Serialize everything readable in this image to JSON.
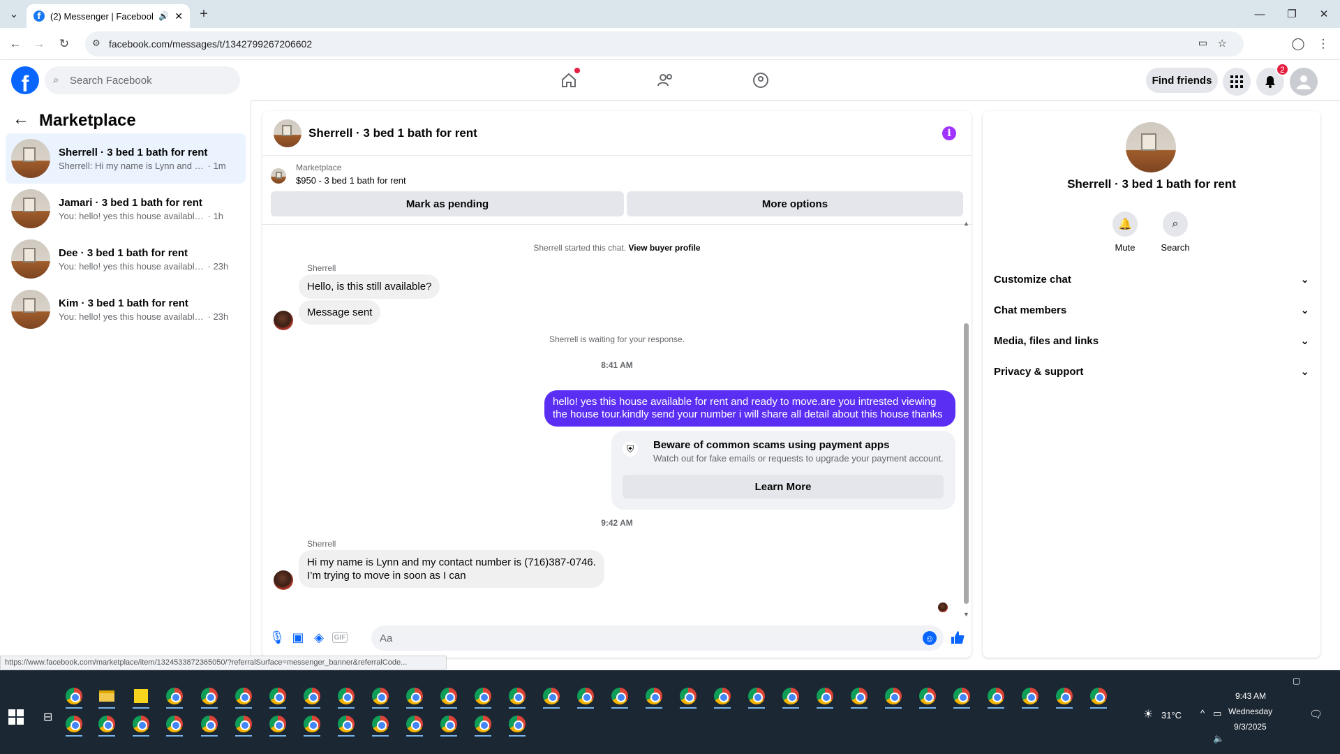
{
  "browser": {
    "tab_title": "(2) Messenger | Facebook",
    "url": "facebook.com/messages/t/1342799267206602",
    "status_url": "https://www.facebook.com/marketplace/item/1324533872365050/?referralSurface=messenger_banner&referralCode..."
  },
  "fb_header": {
    "logo": "f",
    "search_placeholder": "Search Facebook",
    "find_friends": "Find friends",
    "notification_count": "2"
  },
  "left_panel": {
    "title": "Marketplace",
    "conversations": [
      {
        "name": "Sherrell · 3 bed 1 bath for rent",
        "preview": "Sherrell: Hi my name is Lynn and my ...",
        "time": "1m"
      },
      {
        "name": "Jamari · 3 bed 1 bath for rent",
        "preview": "You: hello! yes this house available for...",
        "time": "1h"
      },
      {
        "name": "Dee · 3 bed 1 bath for rent",
        "preview": "You: hello! yes this house available fo...",
        "time": "23h"
      },
      {
        "name": "Kim · 3 bed 1 bath for rent",
        "preview": "You: hello! yes this house available fo...",
        "time": "23h"
      }
    ]
  },
  "chat": {
    "title": "Sherrell · 3 bed 1 bath for rent",
    "marketplace_label": "Marketplace",
    "listing": "$950 - 3 bed 1 bath for rent",
    "mark_pending": "Mark as pending",
    "more_options": "More options",
    "started_text": "Sherrell started this chat.",
    "view_buyer": "View buyer profile",
    "sender1": "Sherrell",
    "msg1": "Hello, is this still available?",
    "msg2": "Message sent",
    "waiting": "Sherrell is waiting for your response.",
    "time1": "8:41 AM",
    "my_msg_line1": "hello! yes this house available for rent and ready to move.are you intrested viewing",
    "my_msg_line2": "the house tour.kindly send your number i will share all detail about this house thanks",
    "scam_title": "Beware of common scams using payment apps",
    "scam_text": "Watch out for fake emails or requests to upgrade your payment account.",
    "learn_more": "Learn More",
    "time2": "9:42 AM",
    "sender2": "Sherrell",
    "msg3_line1": "Hi my name is Lynn and my contact number is (716)387-0746.",
    "msg3_line2": "I’m trying to move in soon as I can",
    "input_placeholder": "Aa"
  },
  "right_panel": {
    "title": "Sherrell · 3 bed 1 bath for rent",
    "mute": "Mute",
    "search": "Search",
    "sections": [
      "Customize chat",
      "Chat members",
      "Media, files and links",
      "Privacy & support"
    ]
  },
  "taskbar": {
    "temperature": "31°C",
    "time": "9:43 AM",
    "day": "Wednesday",
    "date": "9/3/2025"
  },
  "colors": {
    "fb_blue": "#0866ff",
    "my_bubble": "#5b2ff3",
    "badge_red": "#e41e3f",
    "selected_conv": "#ebf3ff"
  }
}
